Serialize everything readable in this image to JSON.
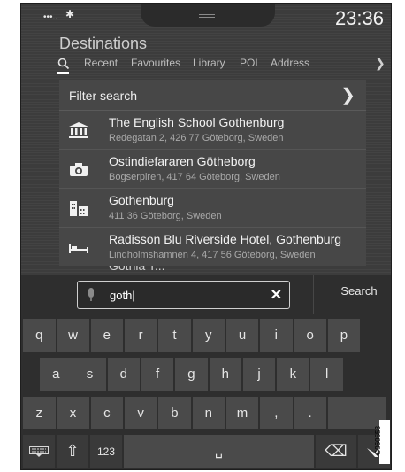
{
  "status": {
    "signal": "•••..",
    "bluetooth": "✱",
    "time": "23:36"
  },
  "header": {
    "title": "Destinations",
    "tabs": [
      "Recent",
      "Favourites",
      "Library",
      "POI",
      "Address"
    ],
    "active_tab_icon": "search-icon",
    "more_icon": "chevron-right-icon"
  },
  "list": {
    "filter_label": "Filter search",
    "items": [
      {
        "icon": "museum-icon",
        "name": "The English School Gothenburg",
        "address": "Redegatan 2, 426 77 Göteborg, Sweden"
      },
      {
        "icon": "camera-icon",
        "name": "Ostindiefararen Götheborg",
        "address": "Bogserpiren, 417 64 Göteborg, Sweden"
      },
      {
        "icon": "city-icon",
        "name": "Gothenburg",
        "address": "411 36 Göteborg, Sweden"
      },
      {
        "icon": "hotel-bed-icon",
        "name": "Radisson Blu Riverside Hotel, Gothenburg",
        "address": "Lindholmshamnen 4, 417 56 Göteborg, Sweden"
      }
    ],
    "partial_item": "Gothia T..."
  },
  "search": {
    "query": "goth|",
    "button_label": "Search"
  },
  "keyboard": {
    "row1": [
      "q",
      "w",
      "e",
      "r",
      "t",
      "y",
      "u",
      "i",
      "o",
      "p"
    ],
    "row2": [
      "a",
      "s",
      "d",
      "f",
      "g",
      "h",
      "j",
      "k",
      "l"
    ],
    "row3": [
      "z",
      "x",
      "c",
      "v",
      "b",
      "n",
      "m",
      ",",
      "."
    ],
    "numbers_label": "123",
    "space_symbol": "␣",
    "backspace_symbol": "⌫"
  },
  "side_label": "G060553"
}
